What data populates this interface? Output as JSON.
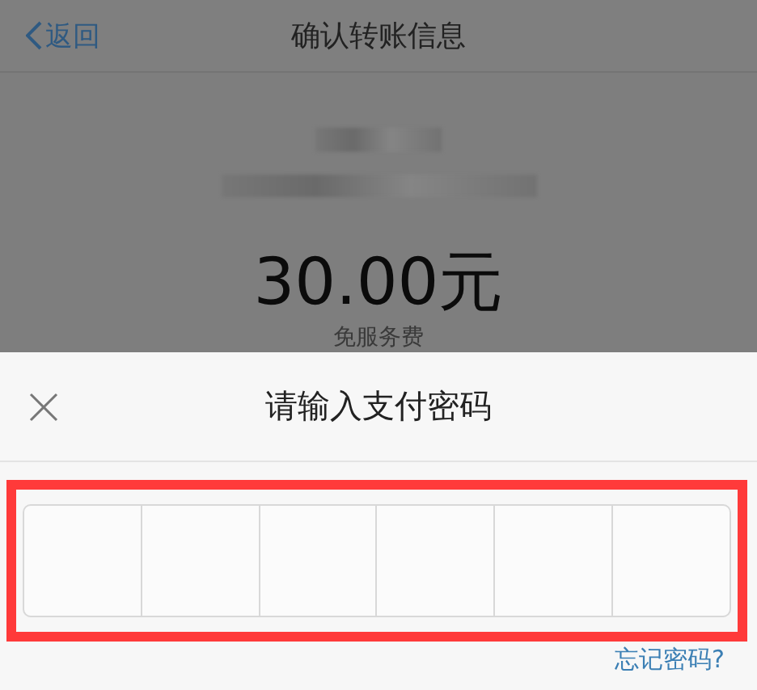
{
  "nav_bar": {
    "back": "返回",
    "title": "确认转账信息"
  },
  "transfer": {
    "amount": "30.00元",
    "fee_note": "免服务费"
  },
  "password_sheet": {
    "title": "请输入支付密码",
    "forgot_link": "忘记密码?"
  }
}
